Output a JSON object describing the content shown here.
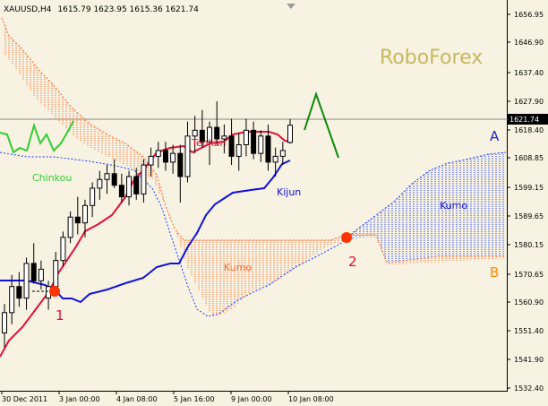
{
  "window": {
    "title": "XAUUSD,H4",
    "ohlc_readout": "1615.79 1623.95 1615.36 1621.74",
    "dropdown_icon": "triangle-down-icon"
  },
  "watermark": "RoboForex",
  "price_axis": {
    "ticks": [
      "1656.95",
      "1646.90",
      "1637.40",
      "1627.90",
      "1618.40",
      "1608.85",
      "1599.15",
      "1589.65",
      "1580.15",
      "1570.65",
      "1560.90",
      "1551.40",
      "1541.90",
      "1532.40"
    ],
    "current_price_label": "1621.74"
  },
  "time_axis": {
    "ticks": [
      "30 Dec 2011",
      "3 Jan 00:00",
      "4 Jan 08:00",
      "5 Jan 16:00",
      "9 Jan 00:00",
      "10 Jan 08:00"
    ]
  },
  "annotations": {
    "chinkou": "Chinkou",
    "tenkan": "Tenkan",
    "kijun": "Kijun",
    "kumo_left": "Kumo",
    "kumo_right": "Kumo",
    "marker1": "1",
    "marker2": "2",
    "label_a": "A",
    "label_b": "B"
  },
  "colors": {
    "background": "#f7f2e1",
    "tenkan": "#e0103a",
    "kijun": "#1010e0",
    "chinkou": "#33cc33",
    "kumo_bull": "#ff6a2a",
    "kumo_bear": "#1a3cff",
    "arrow": "#0a8a0a",
    "marker": "#ff3300",
    "label_a": "#2020d0",
    "label_b": "#ff8c00",
    "watermark": "#c8b860"
  },
  "chart_data": {
    "type": "candlestick",
    "symbol": "XAUUSD",
    "timeframe": "H4",
    "ylim": [
      1530,
      1665
    ],
    "candles": [
      {
        "o": 1550,
        "h": 1560,
        "l": 1545,
        "c": 1557
      },
      {
        "o": 1557,
        "h": 1570,
        "l": 1553,
        "c": 1566
      },
      {
        "o": 1566,
        "h": 1571,
        "l": 1559,
        "c": 1562
      },
      {
        "o": 1562,
        "h": 1576,
        "l": 1558,
        "c": 1574
      },
      {
        "o": 1574,
        "h": 1581,
        "l": 1567,
        "c": 1568
      },
      {
        "o": 1568,
        "h": 1575,
        "l": 1565,
        "c": 1572
      },
      {
        "o": 1562,
        "h": 1568,
        "l": 1558,
        "c": 1566
      },
      {
        "o": 1566,
        "h": 1578,
        "l": 1563,
        "c": 1575
      },
      {
        "o": 1575,
        "h": 1585,
        "l": 1573,
        "c": 1583
      },
      {
        "o": 1583,
        "h": 1592,
        "l": 1581,
        "c": 1590
      },
      {
        "o": 1590,
        "h": 1597,
        "l": 1584,
        "c": 1588
      },
      {
        "o": 1588,
        "h": 1596,
        "l": 1583,
        "c": 1594
      },
      {
        "o": 1594,
        "h": 1602,
        "l": 1590,
        "c": 1600
      },
      {
        "o": 1600,
        "h": 1606,
        "l": 1596,
        "c": 1603
      },
      {
        "o": 1603,
        "h": 1608,
        "l": 1598,
        "c": 1605
      },
      {
        "o": 1605,
        "h": 1610,
        "l": 1600,
        "c": 1601
      },
      {
        "o": 1601,
        "h": 1605,
        "l": 1595,
        "c": 1597
      },
      {
        "o": 1597,
        "h": 1606,
        "l": 1594,
        "c": 1604
      },
      {
        "o": 1604,
        "h": 1607,
        "l": 1596,
        "c": 1598
      },
      {
        "o": 1598,
        "h": 1610,
        "l": 1595,
        "c": 1608
      },
      {
        "o": 1608,
        "h": 1614,
        "l": 1604,
        "c": 1611
      },
      {
        "o": 1611,
        "h": 1616,
        "l": 1607,
        "c": 1613
      },
      {
        "o": 1613,
        "h": 1616,
        "l": 1606,
        "c": 1609
      },
      {
        "o": 1609,
        "h": 1615,
        "l": 1605,
        "c": 1612
      },
      {
        "o": 1612,
        "h": 1615,
        "l": 1595,
        "c": 1604
      },
      {
        "o": 1604,
        "h": 1623,
        "l": 1602,
        "c": 1618
      },
      {
        "o": 1618,
        "h": 1625,
        "l": 1612,
        "c": 1620
      },
      {
        "o": 1620,
        "h": 1627,
        "l": 1614,
        "c": 1616
      },
      {
        "o": 1616,
        "h": 1623,
        "l": 1608,
        "c": 1621
      },
      {
        "o": 1621,
        "h": 1630,
        "l": 1615,
        "c": 1617
      },
      {
        "o": 1617,
        "h": 1622,
        "l": 1612,
        "c": 1618
      },
      {
        "o": 1618,
        "h": 1624,
        "l": 1608,
        "c": 1611
      },
      {
        "o": 1611,
        "h": 1619,
        "l": 1606,
        "c": 1615
      },
      {
        "o": 1615,
        "h": 1624,
        "l": 1611,
        "c": 1620
      },
      {
        "o": 1620,
        "h": 1623,
        "l": 1610,
        "c": 1612
      },
      {
        "o": 1612,
        "h": 1620,
        "l": 1609,
        "c": 1618
      },
      {
        "o": 1618,
        "h": 1622,
        "l": 1606,
        "c": 1609
      },
      {
        "o": 1609,
        "h": 1614,
        "l": 1604,
        "c": 1611
      },
      {
        "o": 1611,
        "h": 1616,
        "l": 1608,
        "c": 1613
      },
      {
        "o": 1615.79,
        "h": 1623.95,
        "l": 1615.36,
        "c": 1621.74
      }
    ],
    "current_price": 1621.74
  }
}
